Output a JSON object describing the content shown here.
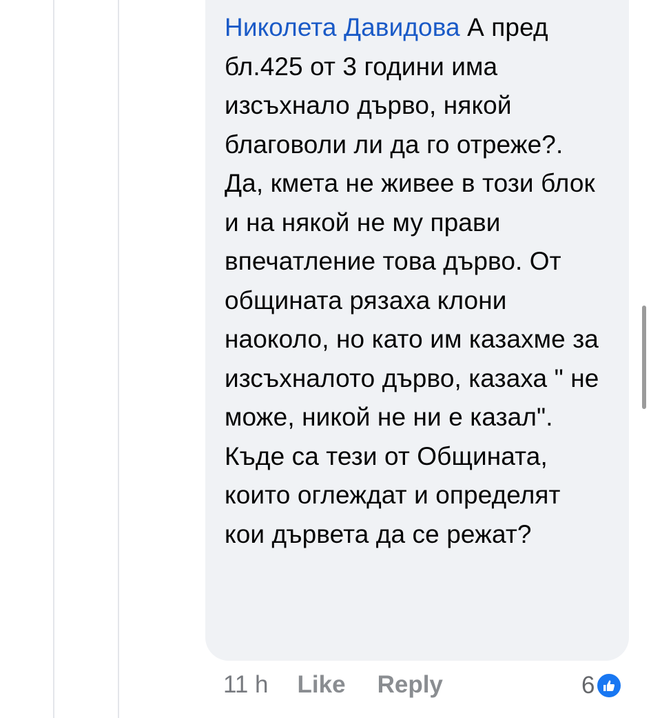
{
  "comment": {
    "author": "Николета Давидова",
    "text": "А пред бл.425 от 3 години има изсъхнало дърво, някой благоволи ли да го отреже?. Да, кмета не живее в този блок и на някой не му прави впечатление това дърво. От общината рязаха клони наоколо, но като им казахме за изсъхналото дърво, казаха \" не може, никой не ни е казал\". Къде са тези от Общината, които оглеждат и определят кои дървета да се режат?"
  },
  "actions": {
    "time": "11 h",
    "like_label": "Like",
    "reply_label": "Reply"
  },
  "reactions": {
    "count": "6",
    "icon": "thumbs-up-icon",
    "color": "#1877f2"
  },
  "colors": {
    "author": "#1a5ac7",
    "bubble": "#f0f2f5"
  }
}
